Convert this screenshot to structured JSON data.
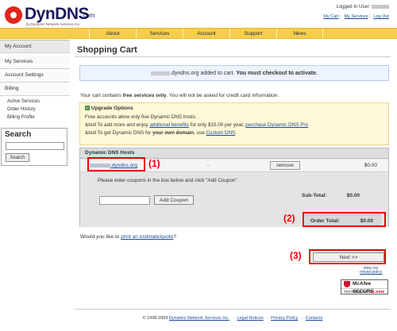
{
  "header": {
    "logo_text": "DynDNS",
    "logo_dotcom": ".com",
    "logo_tagline": "by Dynamic Network Services Inc.",
    "logged_in_label": "Logged In User:",
    "links": [
      "My Cart",
      "My Services",
      "Log Out"
    ]
  },
  "nav": {
    "items": [
      "About",
      "Services",
      "Account",
      "Support",
      "News"
    ]
  },
  "sidebar": {
    "my_account": "My Account",
    "my_services": "My Services",
    "account_settings": "Account Settings",
    "billing": "Billing",
    "billing_items": [
      "Active Services",
      "Order History",
      "Billing Profile"
    ],
    "search_title": "Search",
    "search_button": "Search",
    "search_value": ""
  },
  "main": {
    "title": "Shopping Cart",
    "notice_suffix": ".dyndns.org added to cart.",
    "notice_bold": "You must checkout to activate.",
    "free_pre": "Your cart contains ",
    "free_bold": "free services only",
    "free_post": ". You will not be asked for credit card information.",
    "upgrade": {
      "title": "Upgrade Options",
      "line1": "Free accounts allow only five Dynamic DNS hosts.",
      "line2_pre": "&bull To add more and enjoy ",
      "line2_link1": "additonal benefits",
      "line2_mid": " for only $15.00 per year, ",
      "line2_link2": "purchase Dynamic DNS Pro",
      "line3_pre": "&bull To get Dynamic DNS for ",
      "line3_bold": "your own domain",
      "line3_mid": ", use ",
      "line3_link": "Custom DNS",
      "line3_post": "."
    },
    "hosts": {
      "header": "Dynamic DNS Hosts",
      "host_suffix": ".dyndns.org",
      "dash": "-",
      "remove_label": "remove",
      "price": "$0.00",
      "coupon_text": "Please enter coupons in the box below and click \"Add Coupon\".",
      "coupon_value": "",
      "add_coupon_label": "Add Coupon",
      "subtotal_label": "Sub-Total:",
      "subtotal_value": "$0.00",
      "total_label": "Order Total:",
      "total_value": "$0.00"
    },
    "estimate_pre": "Would you like to ",
    "estimate_link": "print an estimate/quote",
    "estimate_post": "?",
    "next_label": "Next >>",
    "refund_line1": "view our",
    "refund_line2": "refund policy",
    "mcafee_top": "McAfee SECURE",
    "mcafee_tested": "TESTED DAILY",
    "mcafee_date": "29-JUNE"
  },
  "footer": {
    "copyright": "© 1998-2009 ",
    "company_link": "Dynamic Network Services Inc.",
    "links": [
      "Legal Notices",
      "Privacy Policy",
      "Contacts"
    ],
    "separator": "-"
  },
  "annotations": [
    "(1)",
    "(2)",
    "(3)"
  ],
  "colors": {
    "nav_bg": "#f5cf4a",
    "notice_bg": "#eef4ff",
    "upgrade_bg": "#fff8d6",
    "annotation_red": "#e00000",
    "link": "#1a4a9a"
  }
}
